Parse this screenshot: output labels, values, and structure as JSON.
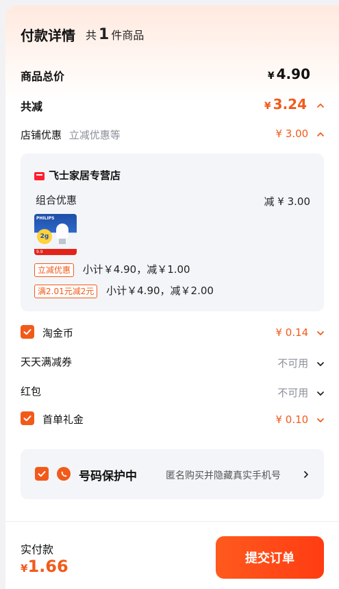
{
  "header": {
    "title": "付款详情",
    "count_prefix": "共",
    "count": "1",
    "count_suffix": "件商品"
  },
  "summary": {
    "total_label": "商品总价",
    "total_value": "4.90",
    "discount_label": "共减",
    "discount_value": "3.24",
    "currency": "¥"
  },
  "store_discount": {
    "label": "店铺优惠",
    "sublabel": "立减优惠等",
    "value": "¥ 3.00"
  },
  "store_card": {
    "badge": "天猫",
    "store_name": "飞士家居专营店",
    "combo_label": "组合优惠",
    "combo_value": "减 ¥ 3.00",
    "product_brand": "PHILIPS",
    "product_badge": "2g",
    "product_promo": "9.9",
    "promo_rows": [
      {
        "tag": "立减优惠",
        "text": "小计￥4.90，减￥1.00"
      },
      {
        "tag": "满2.01元减2元",
        "text": "小计￥4.90，减￥2.00"
      }
    ]
  },
  "options": [
    {
      "label": "淘金币",
      "value": "¥ 0.14",
      "checked": true,
      "status": "active"
    },
    {
      "label": "天天满减券",
      "value": "不可用",
      "checked": false,
      "status": "unavailable"
    },
    {
      "label": "红包",
      "value": "不可用",
      "checked": false,
      "status": "unavailable"
    },
    {
      "label": "首单礼金",
      "value": "¥ 0.10",
      "checked": true,
      "status": "active"
    }
  ],
  "privacy": {
    "title": "号码保护中",
    "description": "匿名购买并隐藏真实手机号"
  },
  "footer": {
    "pay_label": "实付款",
    "currency": "¥",
    "pay_value": "1.66",
    "submit_label": "提交订单"
  },
  "colors": {
    "accent": "#f25a1a",
    "muted": "#8a8f99",
    "card_bg": "#f3f5f8"
  },
  "icons": [
    "chevron-up-icon",
    "chevron-down-icon",
    "chevron-right-icon",
    "check-icon",
    "phone-shield-icon",
    "tmall-icon"
  ]
}
